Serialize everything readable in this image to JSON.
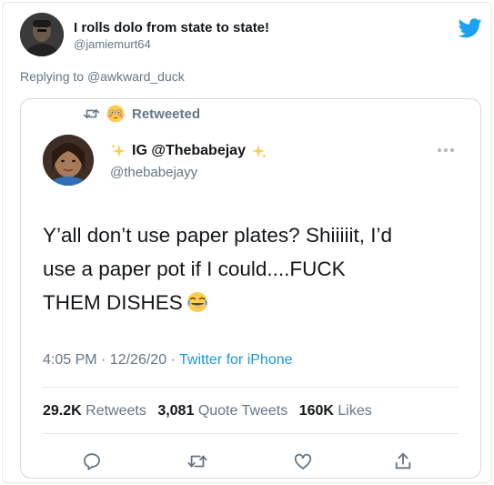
{
  "reply_author": {
    "name": "I rolls dolo from state to state!",
    "handle": "@jamiemurt64",
    "replying_prefix": "Replying to",
    "replying_to": "@awkward_duck"
  },
  "quoted": {
    "retweet_label": "Retweeted",
    "name": "IG @Thebabejay",
    "handle": "@thebabejayy",
    "text_lines": [
      "Y’all don’t use paper plates? Shiiiiit, I’d",
      "use a paper pot if I could....FUCK",
      "THEM DISHES"
    ],
    "time": "4:05 PM · 12/26/20 · ",
    "source": "Twitter for iPhone",
    "stats": {
      "retweets_count": "29.2K",
      "retweets_label": "Retweets",
      "quotes_count": "3,081",
      "quotes_label": "Quote Tweets",
      "likes_count": "160K",
      "likes_label": "Likes"
    }
  },
  "icons": {
    "brand": "twitter-bird-icon",
    "retweet": "retweet-icon",
    "emoji": "flushed-face-emoji",
    "sparkle": "sparkles-emoji",
    "laugh": "tears-of-joy-emoji",
    "more": "more-dots-icon",
    "reply": "reply-icon",
    "like": "heart-icon",
    "share": "share-icon"
  },
  "colors": {
    "twitter_blue": "#1da1f2",
    "link_blue": "#1b95e0",
    "secondary_text": "#657786",
    "primary_text": "#14171a",
    "border": "#cfd9de"
  }
}
